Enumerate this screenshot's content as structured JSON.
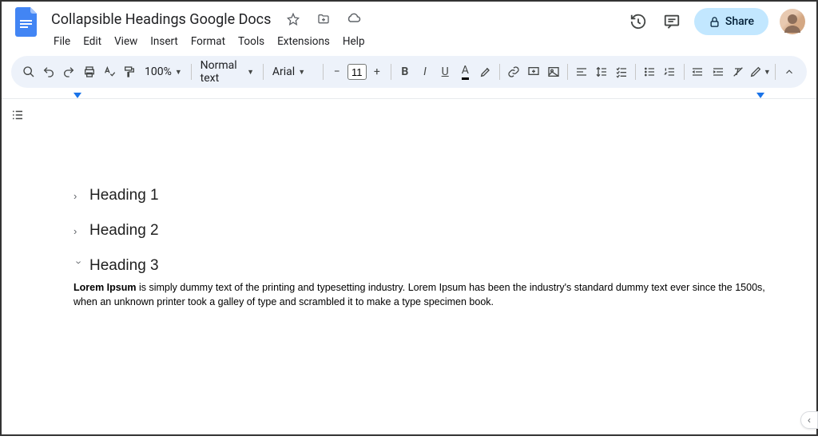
{
  "header": {
    "doc_title": "Collapsible Headings Google Docs",
    "menus": [
      "File",
      "Edit",
      "View",
      "Insert",
      "Format",
      "Tools",
      "Extensions",
      "Help"
    ],
    "share_label": "Share"
  },
  "toolbar": {
    "zoom": "100%",
    "style": "Normal text",
    "font": "Arial",
    "font_size": "11"
  },
  "document": {
    "headings": [
      {
        "label": "Heading 1",
        "expanded": false
      },
      {
        "label": "Heading 2",
        "expanded": false
      },
      {
        "label": "Heading 3",
        "expanded": true
      }
    ],
    "body_bold": "Lorem Ipsum",
    "body_rest": " is simply dummy text of the printing and typesetting industry. Lorem Ipsum has been the industry's standard dummy text ever since the 1500s, when an unknown printer took a galley of type and scrambled it to make a type specimen book."
  }
}
